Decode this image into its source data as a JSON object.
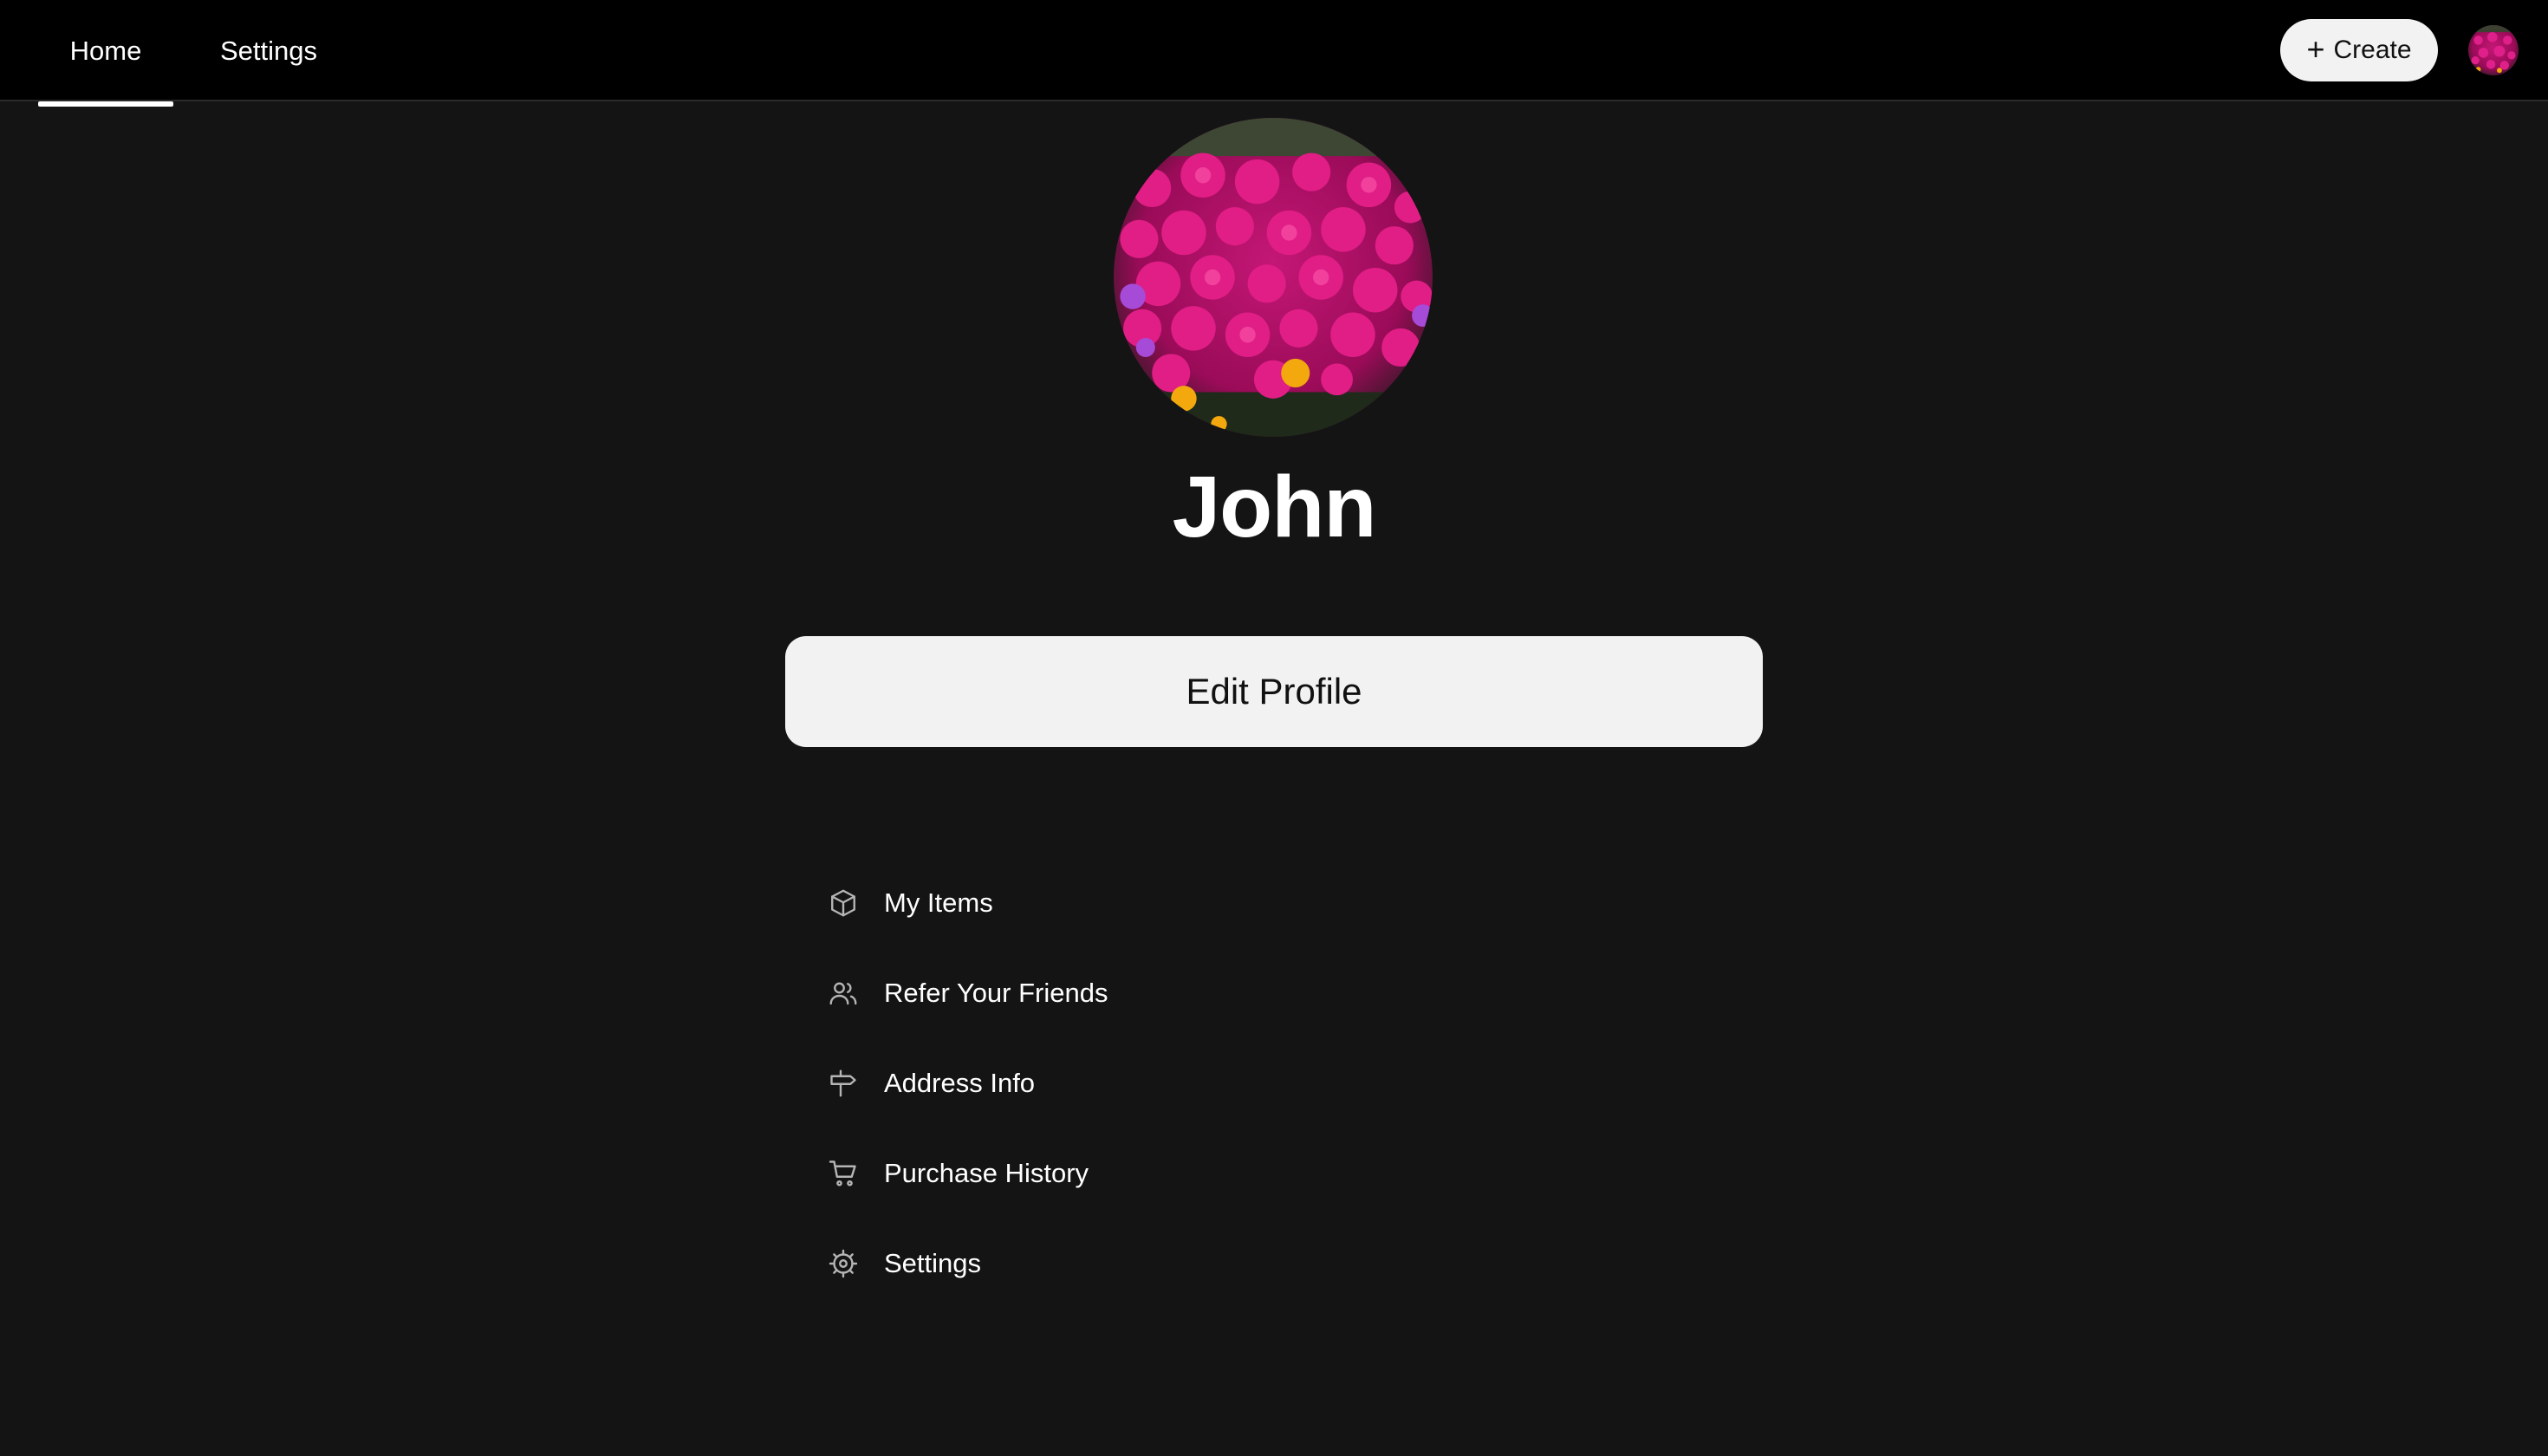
{
  "header": {
    "tabs": [
      {
        "label": "Home",
        "active": true
      },
      {
        "label": "Settings",
        "active": false
      }
    ],
    "create_label": "Create",
    "avatar_icon": "flower-photo-avatar"
  },
  "profile": {
    "name": "John",
    "avatar_icon": "flower-photo-avatar",
    "edit_label": "Edit Profile"
  },
  "menu": {
    "items": [
      {
        "label": "My Items",
        "icon": "box-icon"
      },
      {
        "label": "Refer Your Friends",
        "icon": "users-icon"
      },
      {
        "label": "Address Info",
        "icon": "signpost-icon"
      },
      {
        "label": "Purchase History",
        "icon": "cart-icon"
      },
      {
        "label": "Settings",
        "icon": "gear-icon"
      }
    ]
  },
  "colors": {
    "background": "#141414",
    "topbar": "#000000",
    "button_bg": "#f3f2f2",
    "accent_flowers": "#c8106e"
  }
}
